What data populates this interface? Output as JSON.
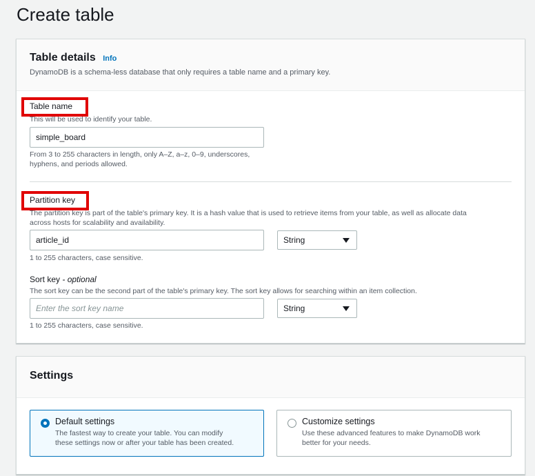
{
  "page": {
    "title": "Create table"
  },
  "table_details": {
    "title": "Table details",
    "info_label": "Info",
    "description": "DynamoDB is a schema-less database that only requires a table name and a primary key.",
    "table_name": {
      "label": "Table name",
      "description": "This will be used to identify your table.",
      "value": "simple_board",
      "hint_line1": "From 3 to 255 characters in length, only A–Z, a–z, 0–9, underscores,",
      "hint_line2": "hyphens, and periods allowed."
    },
    "partition_key": {
      "label": "Partition key",
      "description_line1": "The partition key is part of the table's primary key. It is a hash value that is used to retrieve items from your table, as well as allocate data",
      "description_line2": "across hosts for scalability and availability.",
      "value": "article_id",
      "type": "String",
      "hint": "1 to 255 characters, case sensitive."
    },
    "sort_key": {
      "label": "Sort key",
      "optional_label": "- optional",
      "description": "The sort key can be the second part of the table's primary key. The sort key allows for searching within an item collection.",
      "placeholder": "Enter the sort key name",
      "type": "String",
      "hint": "1 to 255 characters, case sensitive."
    }
  },
  "settings": {
    "title": "Settings",
    "options": [
      {
        "title": "Default settings",
        "description_line1": "The fastest way to create your table. You can modify",
        "description_line2": "these settings now or after your table has been created.",
        "selected": true
      },
      {
        "title": "Customize settings",
        "description_line1": "Use these advanced features to make DynamoDB work",
        "description_line2": "better for your needs.",
        "selected": false
      }
    ]
  },
  "colors": {
    "accent": "#0073bb",
    "highlight_border": "#e00000",
    "background": "#f2f3f3"
  }
}
